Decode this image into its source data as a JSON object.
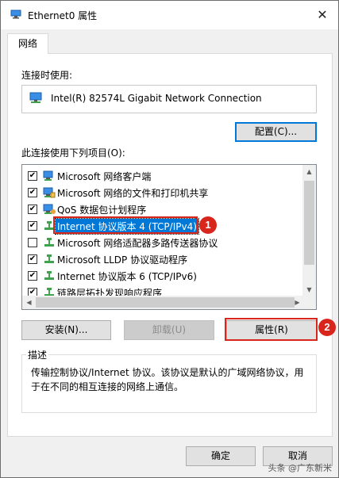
{
  "window": {
    "title": "Ethernet0 属性",
    "close_glyph": "✕"
  },
  "tabs": [
    {
      "label": "网络"
    }
  ],
  "connect_using": {
    "label": "连接时使用:",
    "adapter_name": "Intel(R) 82574L Gigabit Network Connection",
    "configure_button": "配置(C)..."
  },
  "items_section": {
    "label": "此连接使用下列项目(O):",
    "items": [
      {
        "checked": true,
        "icon": "network-client-icon",
        "label": "Microsoft 网络客户端",
        "selected": false
      },
      {
        "checked": true,
        "icon": "file-sharing-icon",
        "label": "Microsoft 网络的文件和打印机共享",
        "selected": false
      },
      {
        "checked": true,
        "icon": "qos-icon",
        "label": "QoS 数据包计划程序",
        "selected": false
      },
      {
        "checked": true,
        "icon": "protocol-icon",
        "label": "Internet 协议版本 4 (TCP/IPv4)",
        "selected": true
      },
      {
        "checked": false,
        "icon": "protocol-icon",
        "label": "Microsoft 网络适配器多路传送器协议",
        "selected": false
      },
      {
        "checked": true,
        "icon": "protocol-icon",
        "label": "Microsoft LLDP 协议驱动程序",
        "selected": false
      },
      {
        "checked": true,
        "icon": "protocol-icon",
        "label": "Internet 协议版本 6 (TCP/IPv6)",
        "selected": false
      },
      {
        "checked": true,
        "icon": "protocol-icon",
        "label": "链路层拓扑发现响应程序",
        "selected": false
      }
    ],
    "check_glyph": "✔"
  },
  "buttons": {
    "install": "安装(N)...",
    "uninstall": "卸载(U)",
    "properties": "属性(R)"
  },
  "description": {
    "legend": "描述",
    "text": "传输控制协议/Internet 协议。该协议是默认的广域网络协议，用于在不同的相互连接的网络上通信。"
  },
  "dialog_buttons": {
    "ok": "确定",
    "cancel": "取消"
  },
  "annotations": {
    "marker_1": "1",
    "marker_2": "2",
    "accent_color": "#d9261c"
  },
  "watermark": "头条 @广东新米",
  "colors": {
    "selection": "#0078d7",
    "window_bg": "#f0f0f0",
    "panel_bg": "#ffffff"
  }
}
